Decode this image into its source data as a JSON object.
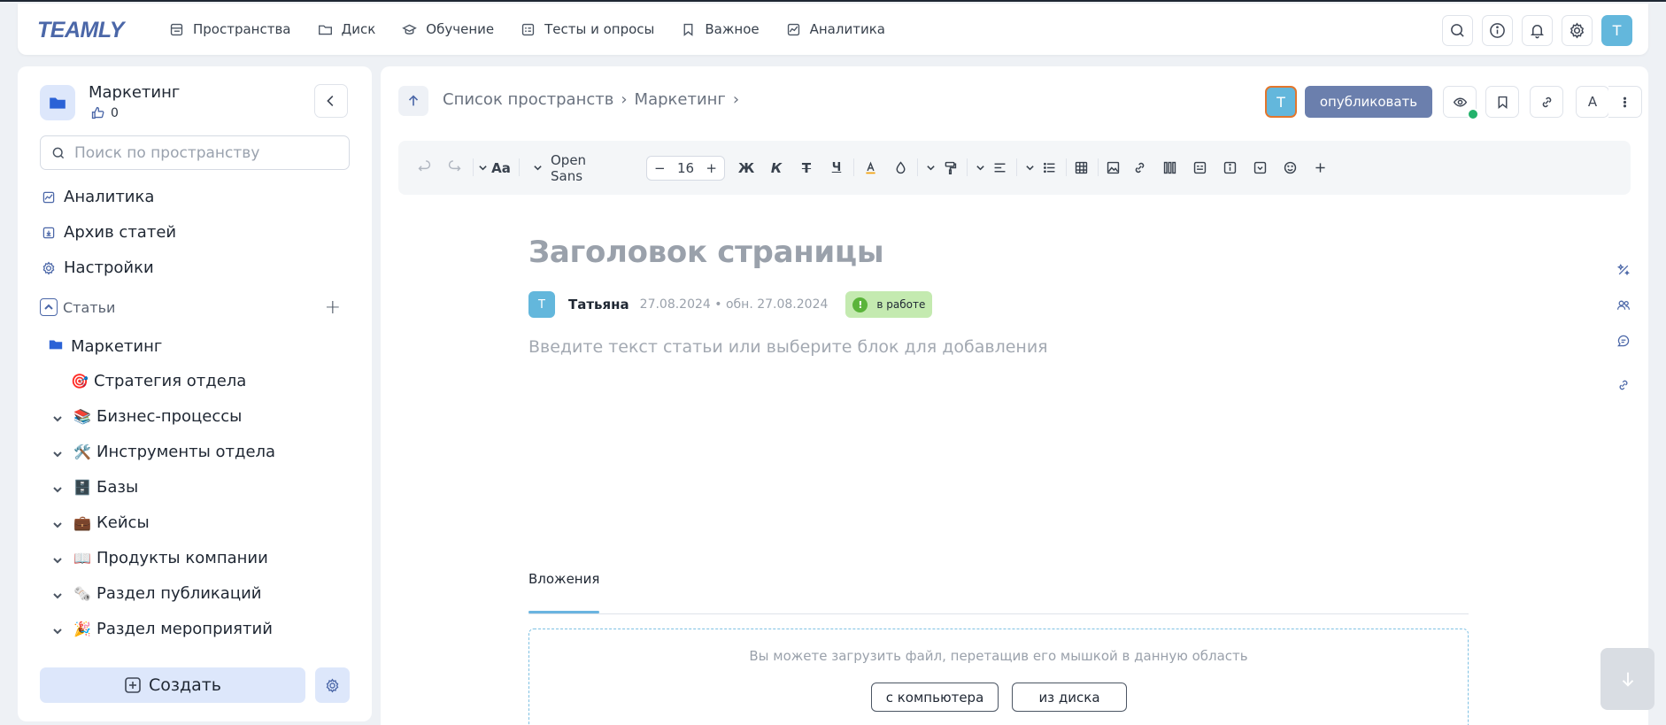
{
  "app": {
    "logo": "TEAMLY"
  },
  "nav": [
    {
      "label": "Пространства",
      "icon": "spaces-icon"
    },
    {
      "label": "Диск",
      "icon": "folder-icon"
    },
    {
      "label": "Обучение",
      "icon": "graduation-icon"
    },
    {
      "label": "Тесты и опросы",
      "icon": "tests-icon"
    },
    {
      "label": "Важное",
      "icon": "bookmark-icon"
    },
    {
      "label": "Аналитика",
      "icon": "analytics-icon"
    }
  ],
  "topbar": {
    "avatar_letter": "Т"
  },
  "sidebar": {
    "space_title": "Маркетинг",
    "likes": "0",
    "search_placeholder": "Поиск по пространству",
    "menu": [
      {
        "label": "Аналитика",
        "icon": "analytics-icon"
      },
      {
        "label": "Архив статей",
        "icon": "archive-icon"
      },
      {
        "label": "Настройки",
        "icon": "gear-icon"
      }
    ],
    "section_label": "Статьи",
    "tree": [
      {
        "label": "Маркетинг",
        "emoji": "📁"
      },
      {
        "label": "Стратегия отдела",
        "emoji": "🎯"
      },
      {
        "label": "Бизнес-процессы",
        "emoji": "📚"
      },
      {
        "label": "Инструменты отдела",
        "emoji": "🛠️"
      },
      {
        "label": "Базы",
        "emoji": "🗄️"
      },
      {
        "label": "Кейсы",
        "emoji": "💼"
      },
      {
        "label": "Продукты компании",
        "emoji": "📖"
      },
      {
        "label": "Раздел публикаций",
        "emoji": "🗞️"
      },
      {
        "label": "Раздел мероприятий",
        "emoji": "🎉"
      }
    ],
    "create_label": "Создать"
  },
  "main": {
    "breadcrumb": [
      "Список пространств",
      "Маркетинг"
    ],
    "publish_avatar": "Т",
    "publish_label": "опубликовать",
    "font_button": "A",
    "toolbar": {
      "font_family": "Open Sans",
      "font_size": "16",
      "bold": "Ж",
      "italic": "К",
      "strike": "Т",
      "underline": "Ч",
      "text_size_icon": "Aa"
    },
    "page_title_placeholder": "Заголовок страницы",
    "author": {
      "avatar": "Т",
      "name": "Татьяна",
      "date": "27.08.2024 • обн. 27.08.2024"
    },
    "status": {
      "icon": "!",
      "label": "в работе"
    },
    "body_placeholder": "Введите текст статьи или выберите блок для добавления",
    "attachments": {
      "tab": "Вложения",
      "hint": "Вы можете загрузить файл, перетащив его мышкой в данную область",
      "from_computer": "с компьютера",
      "from_disk": "из диска"
    }
  },
  "colors": {
    "accent": "#4b67a8",
    "avatar": "#63b7dc",
    "publish": "#6b7fad",
    "status_bg": "#c4eab0",
    "dropzone_border": "#7fc1e3"
  }
}
